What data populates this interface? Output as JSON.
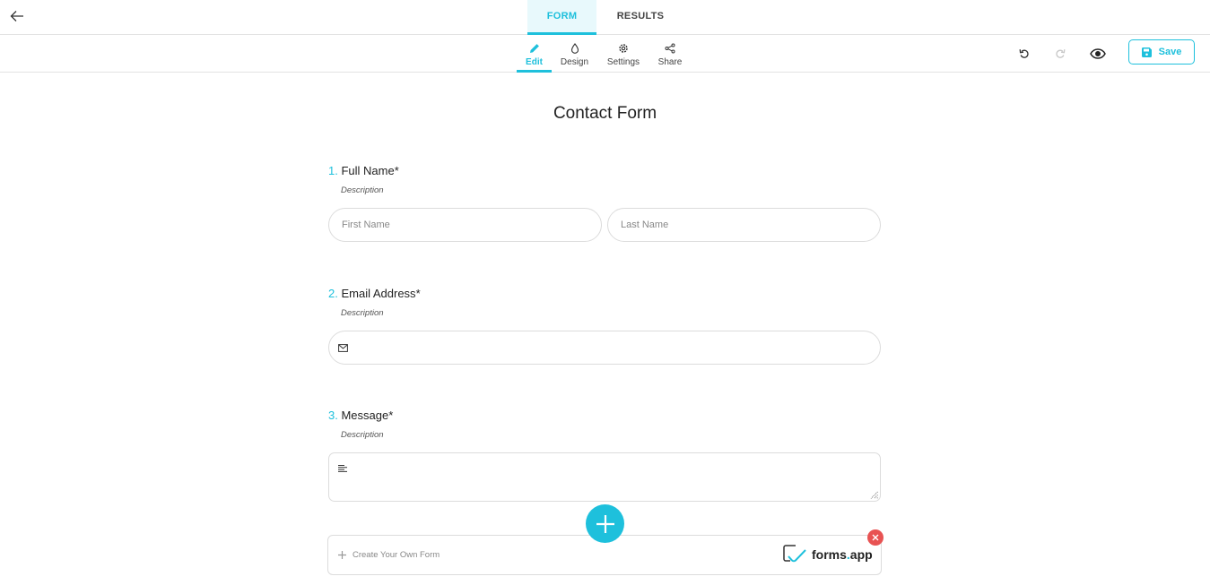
{
  "header": {
    "back_icon": "arrow-left-icon",
    "tabs": [
      {
        "label": "FORM",
        "active": true
      },
      {
        "label": "RESULTS",
        "active": false
      }
    ]
  },
  "toolbar": {
    "sub_tabs": [
      {
        "label": "Edit",
        "icon": "pencil-icon",
        "active": true
      },
      {
        "label": "Design",
        "icon": "droplet-icon",
        "active": false
      },
      {
        "label": "Settings",
        "icon": "gear-icon",
        "active": false
      },
      {
        "label": "Share",
        "icon": "share-icon",
        "active": false
      }
    ],
    "undo_icon": "undo-icon",
    "redo_icon": "redo-icon",
    "preview_icon": "eye-icon",
    "save_label": "Save",
    "save_icon": "floppy-disk-icon"
  },
  "form": {
    "title": "Contact Form",
    "questions": [
      {
        "number": "1.",
        "label": "Full Name",
        "required_mark": "*",
        "description": "Description",
        "fields": [
          {
            "placeholder": "First Name",
            "value": ""
          },
          {
            "placeholder": "Last Name",
            "value": ""
          }
        ]
      },
      {
        "number": "2.",
        "label": "Email Address",
        "required_mark": "*",
        "description": "Description",
        "icon": "envelope-icon",
        "value": ""
      },
      {
        "number": "3.",
        "label": "Message",
        "required_mark": "*",
        "description": "Description",
        "icon": "text-lines-icon",
        "value": ""
      }
    ]
  },
  "promo": {
    "link_label": "Create Your Own Form",
    "brand_name_prefix": "forms",
    "brand_name_dot": ".",
    "brand_name_suffix": "app"
  },
  "colors": {
    "accent": "#1ec0dc",
    "close": "#e85353"
  }
}
